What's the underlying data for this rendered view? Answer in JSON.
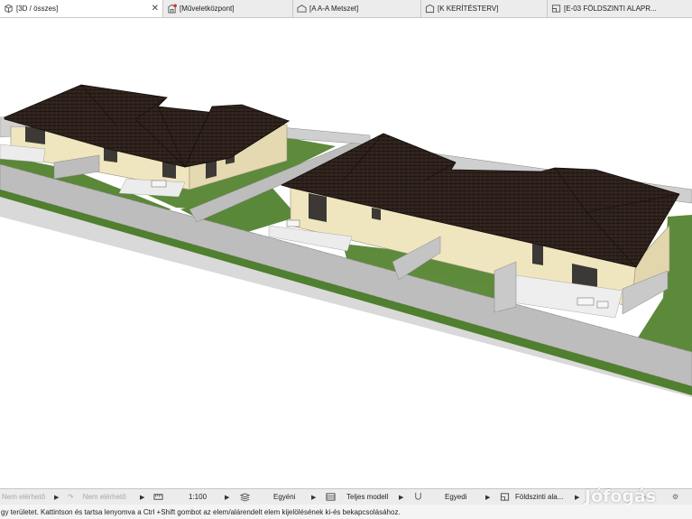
{
  "tabs": [
    {
      "label": "[3D / összes]",
      "icon": "cube-icon",
      "active": true
    },
    {
      "label": "[Műveletközpont]",
      "icon": "building-icon",
      "active": false
    },
    {
      "label": "[A A-A Metszet]",
      "icon": "section-icon",
      "active": false
    },
    {
      "label": "[K KERÍTÉSTERV]",
      "icon": "elevation-icon",
      "active": false
    },
    {
      "label": "[E-03 FÖLDSZINTI ALAPR...",
      "icon": "floorplan-icon",
      "active": false
    }
  ],
  "statusbar": {
    "undo": "Nem elérhető",
    "redo": "Nem elérhető",
    "scale": "1:100",
    "layer_combo": "Egyéni",
    "model_view": "Teljes modell",
    "pen_set": "Egyedi",
    "story": "Földszinti ala..."
  },
  "hint": "gy területet. Kattintson és tartsa lenyomva a Ctrl +Shift gombot az elem/alárendelt elem kijelölésének ki-és bekapcsolásához.",
  "watermark": "Jófogás",
  "colors": {
    "roof": "#2e211c",
    "wall": "#efe5bf",
    "grass": "#5e8a3b",
    "fence": "#a8a8a8",
    "terrace": "#e9e9e9"
  }
}
